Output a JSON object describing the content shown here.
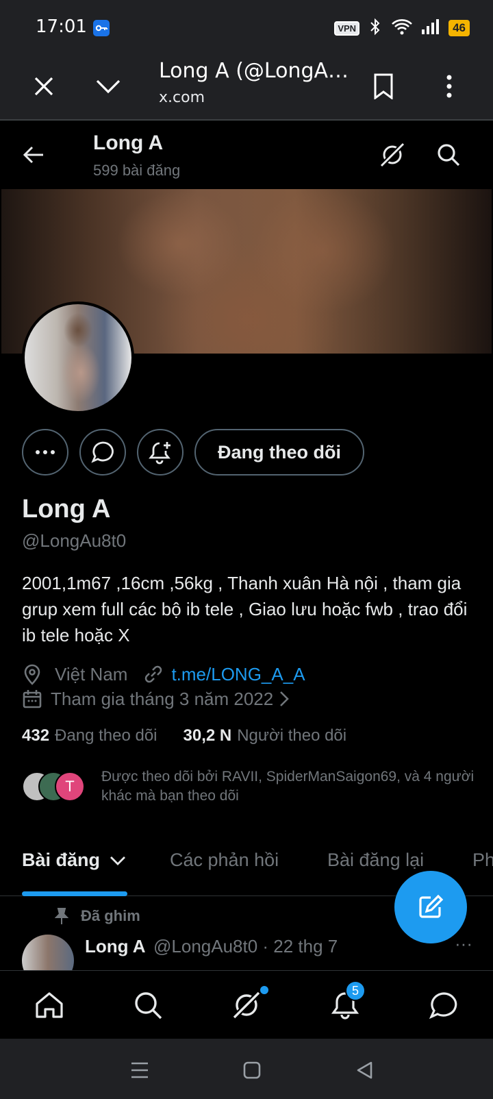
{
  "status_bar": {
    "time": "17:01",
    "vpn": "VPN",
    "battery": "46"
  },
  "browser": {
    "tab_title": "Long A (@LongA…",
    "url": "x.com"
  },
  "header": {
    "name": "Long A",
    "post_count": "599 bài đăng"
  },
  "profile": {
    "name": "Long A",
    "handle": "@LongAu8t0",
    "bio": "2001,1m67 ,16cm ,56kg , Thanh xuân Hà nội , tham gia grup xem full các bộ ib tele , Giao lưu hoặc fwb , trao đổi ib tele hoặc X",
    "location": "Việt Nam",
    "link": "t.me/LONG_A_A",
    "joined": "Tham gia tháng 3 năm 2022",
    "following_count": "432",
    "following_label": "Đang theo dõi",
    "followers_count": "30,2 N",
    "followers_label": "Người theo dõi",
    "followed_by": "Được theo dõi bởi RAVII, SpiderManSaigon69, và 4 người khác mà bạn theo dõi",
    "mini_avatar_letter": "T"
  },
  "actions": {
    "follow_label": "Đang theo dõi"
  },
  "tabs": [
    {
      "label": "Bài đăng"
    },
    {
      "label": "Các phản hồi"
    },
    {
      "label": "Bài đăng lại"
    },
    {
      "label": "Ph"
    }
  ],
  "pinned": {
    "label": "Đã ghim",
    "author": "Long A",
    "meta": "@LongAu8t0 · 22 thg 7",
    "more": "···"
  },
  "bottom_nav": {
    "notification_count": "5"
  },
  "colors": {
    "accent": "#1d9bf0",
    "muted": "#71767b",
    "text": "#e7e9ea"
  }
}
